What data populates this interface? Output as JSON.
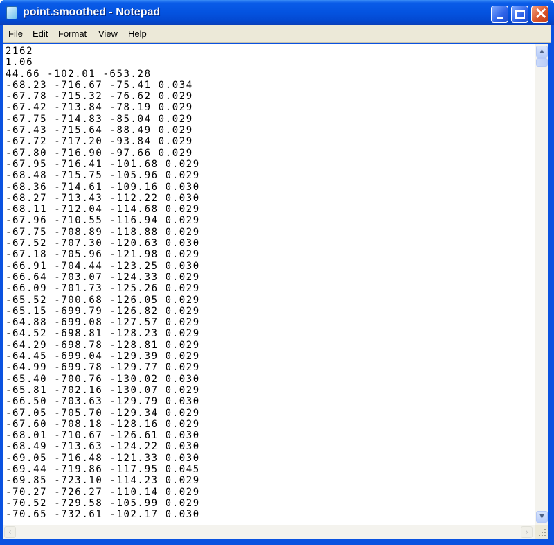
{
  "window": {
    "title": "point.smoothed - Notepad",
    "icon": "notepad-icon"
  },
  "title_buttons": {
    "minimize": "minimize-icon",
    "maximize": "maximize-icon",
    "close": "close-icon"
  },
  "menu": [
    "File",
    "Edit",
    "Format",
    "View",
    "Help"
  ],
  "document": {
    "lines": [
      "2162",
      "1.06",
      "44.66 -102.01 -653.28",
      "-68.23 -716.67 -75.41 0.034",
      "-67.78 -715.32 -76.62 0.029",
      "-67.42 -713.84 -78.19 0.029",
      "-67.75 -714.83 -85.04 0.029",
      "-67.43 -715.64 -88.49 0.029",
      "-67.72 -717.20 -93.84 0.029",
      "-67.80 -716.90 -97.66 0.029",
      "-67.95 -716.41 -101.68 0.029",
      "-68.48 -715.75 -105.96 0.029",
      "-68.36 -714.61 -109.16 0.030",
      "-68.27 -713.43 -112.22 0.030",
      "-68.11 -712.04 -114.68 0.029",
      "-67.96 -710.55 -116.94 0.029",
      "-67.75 -708.89 -118.88 0.029",
      "-67.52 -707.30 -120.63 0.030",
      "-67.18 -705.96 -121.98 0.029",
      "-66.91 -704.44 -123.25 0.030",
      "-66.64 -703.07 -124.33 0.029",
      "-66.09 -701.73 -125.26 0.029",
      "-65.52 -700.68 -126.05 0.029",
      "-65.15 -699.79 -126.82 0.029",
      "-64.88 -699.08 -127.57 0.029",
      "-64.52 -698.81 -128.23 0.029",
      "-64.29 -698.78 -128.81 0.029",
      "-64.45 -699.04 -129.39 0.029",
      "-64.99 -699.78 -129.77 0.029",
      "-65.40 -700.76 -130.02 0.030",
      "-65.81 -702.16 -130.07 0.029",
      "-66.50 -703.63 -129.79 0.030",
      "-67.05 -705.70 -129.34 0.029",
      "-67.60 -708.18 -128.16 0.029",
      "-68.01 -710.67 -126.61 0.030",
      "-68.49 -713.63 -124.22 0.030",
      "-69.05 -716.48 -121.33 0.030",
      "-69.44 -719.86 -117.95 0.045",
      "-69.85 -723.10 -114.23 0.029",
      "-70.27 -726.27 -110.14 0.029",
      "-70.52 -729.58 -105.99 0.029",
      "-70.65 -732.61 -102.17 0.030"
    ]
  }
}
